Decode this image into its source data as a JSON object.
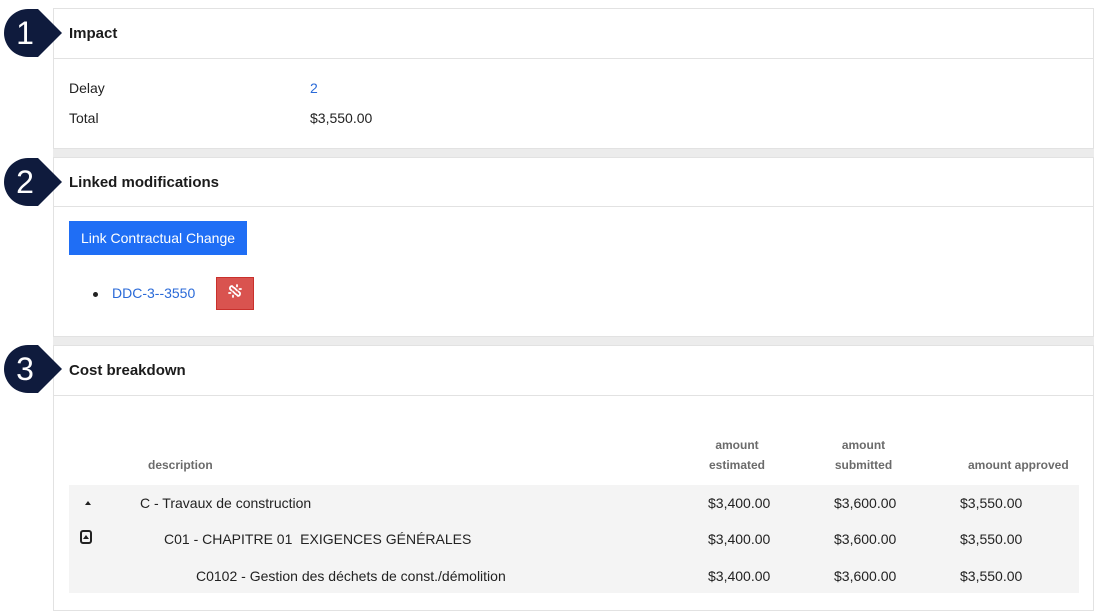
{
  "badges": [
    "1",
    "2",
    "3"
  ],
  "impact": {
    "title": "Impact",
    "delay_label": "Delay",
    "delay_value": "2",
    "total_label": "Total",
    "total_value": "$3,550.00"
  },
  "linked": {
    "title": "Linked modifications",
    "link_button": "Link Contractual Change",
    "items": [
      {
        "label": "DDC-3--3550",
        "action_icon": "unlink-icon"
      }
    ]
  },
  "cost": {
    "title": "Cost breakdown",
    "headers": {
      "description": "description",
      "estimated_line1": "amount",
      "estimated_line2": "estimated",
      "submitted_line1": "amount",
      "submitted_line2": "submitted",
      "approved": "amount approved"
    },
    "rows": [
      {
        "description": "C - Travaux de construction",
        "estimated": "$3,400.00",
        "submitted": "$3,600.00",
        "approved": "$3,550.00"
      },
      {
        "description": "C01 - CHAPITRE 01  EXIGENCES GÉNÉRALES",
        "estimated": "$3,400.00",
        "submitted": "$3,600.00",
        "approved": "$3,550.00"
      },
      {
        "description": "C0102 - Gestion des déchets de const./démolition",
        "estimated": "$3,400.00",
        "submitted": "$3,600.00",
        "approved": "$3,550.00"
      }
    ]
  },
  "colors": {
    "badge": "#0f1b3d",
    "primary": "#1f6ef5",
    "danger": "#d9534f",
    "link": "#2a6ad8"
  }
}
